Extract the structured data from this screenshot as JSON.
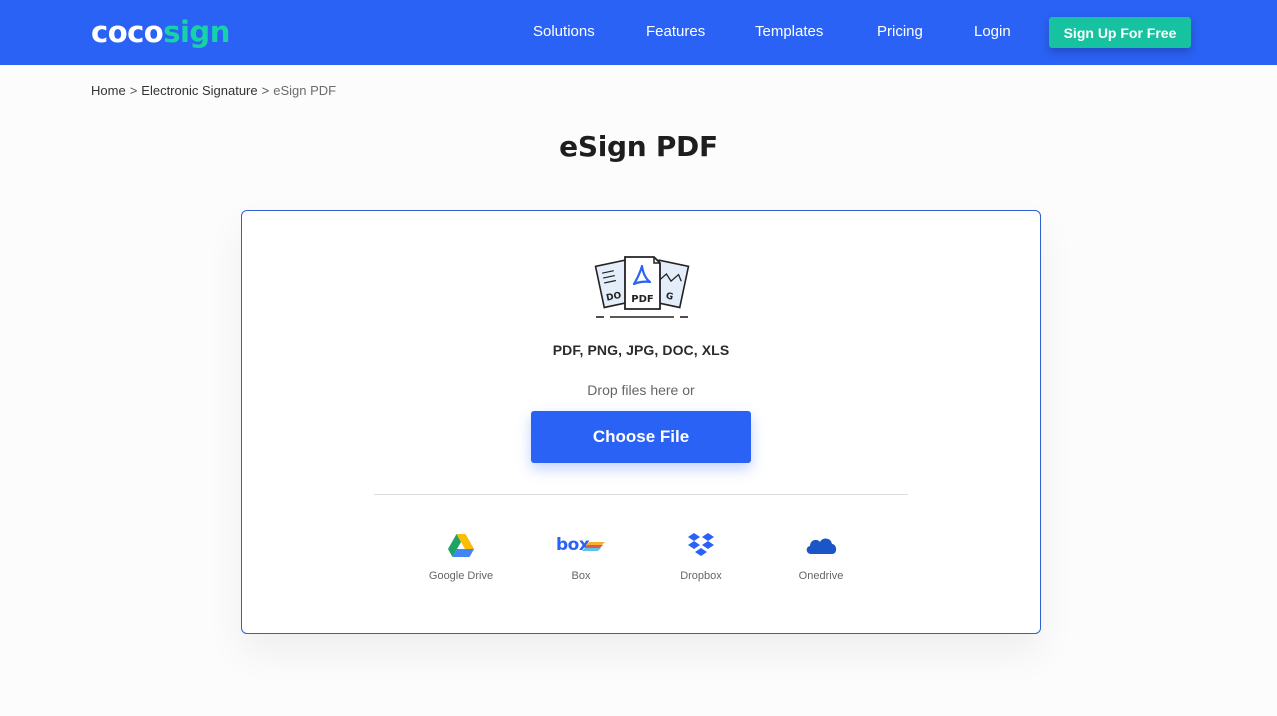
{
  "header": {
    "logo_part1": "coco",
    "logo_part2": "sign",
    "nav": [
      "Solutions",
      "Features",
      "Templates",
      "Pricing",
      "Login"
    ],
    "signup_label": "Sign Up For Free",
    "brand_color": "#2a62f5",
    "accent_color": "#16c2a0"
  },
  "breadcrumb": {
    "items": [
      "Home",
      "Electronic Signature",
      "eSign PDF"
    ],
    "separator": ">"
  },
  "page": {
    "title": "eSign PDF"
  },
  "upload": {
    "illustration_label": "PDF",
    "formats": "PDF, PNG, JPG, DOC, XLS",
    "drop_text": "Drop files here or",
    "choose_label": "Choose File",
    "sources": [
      {
        "label": "Google Drive",
        "icon": "google-drive-icon"
      },
      {
        "label": "Box",
        "icon": "box-icon"
      },
      {
        "label": "Dropbox",
        "icon": "dropbox-icon"
      },
      {
        "label": "Onedrive",
        "icon": "onedrive-icon"
      }
    ]
  }
}
